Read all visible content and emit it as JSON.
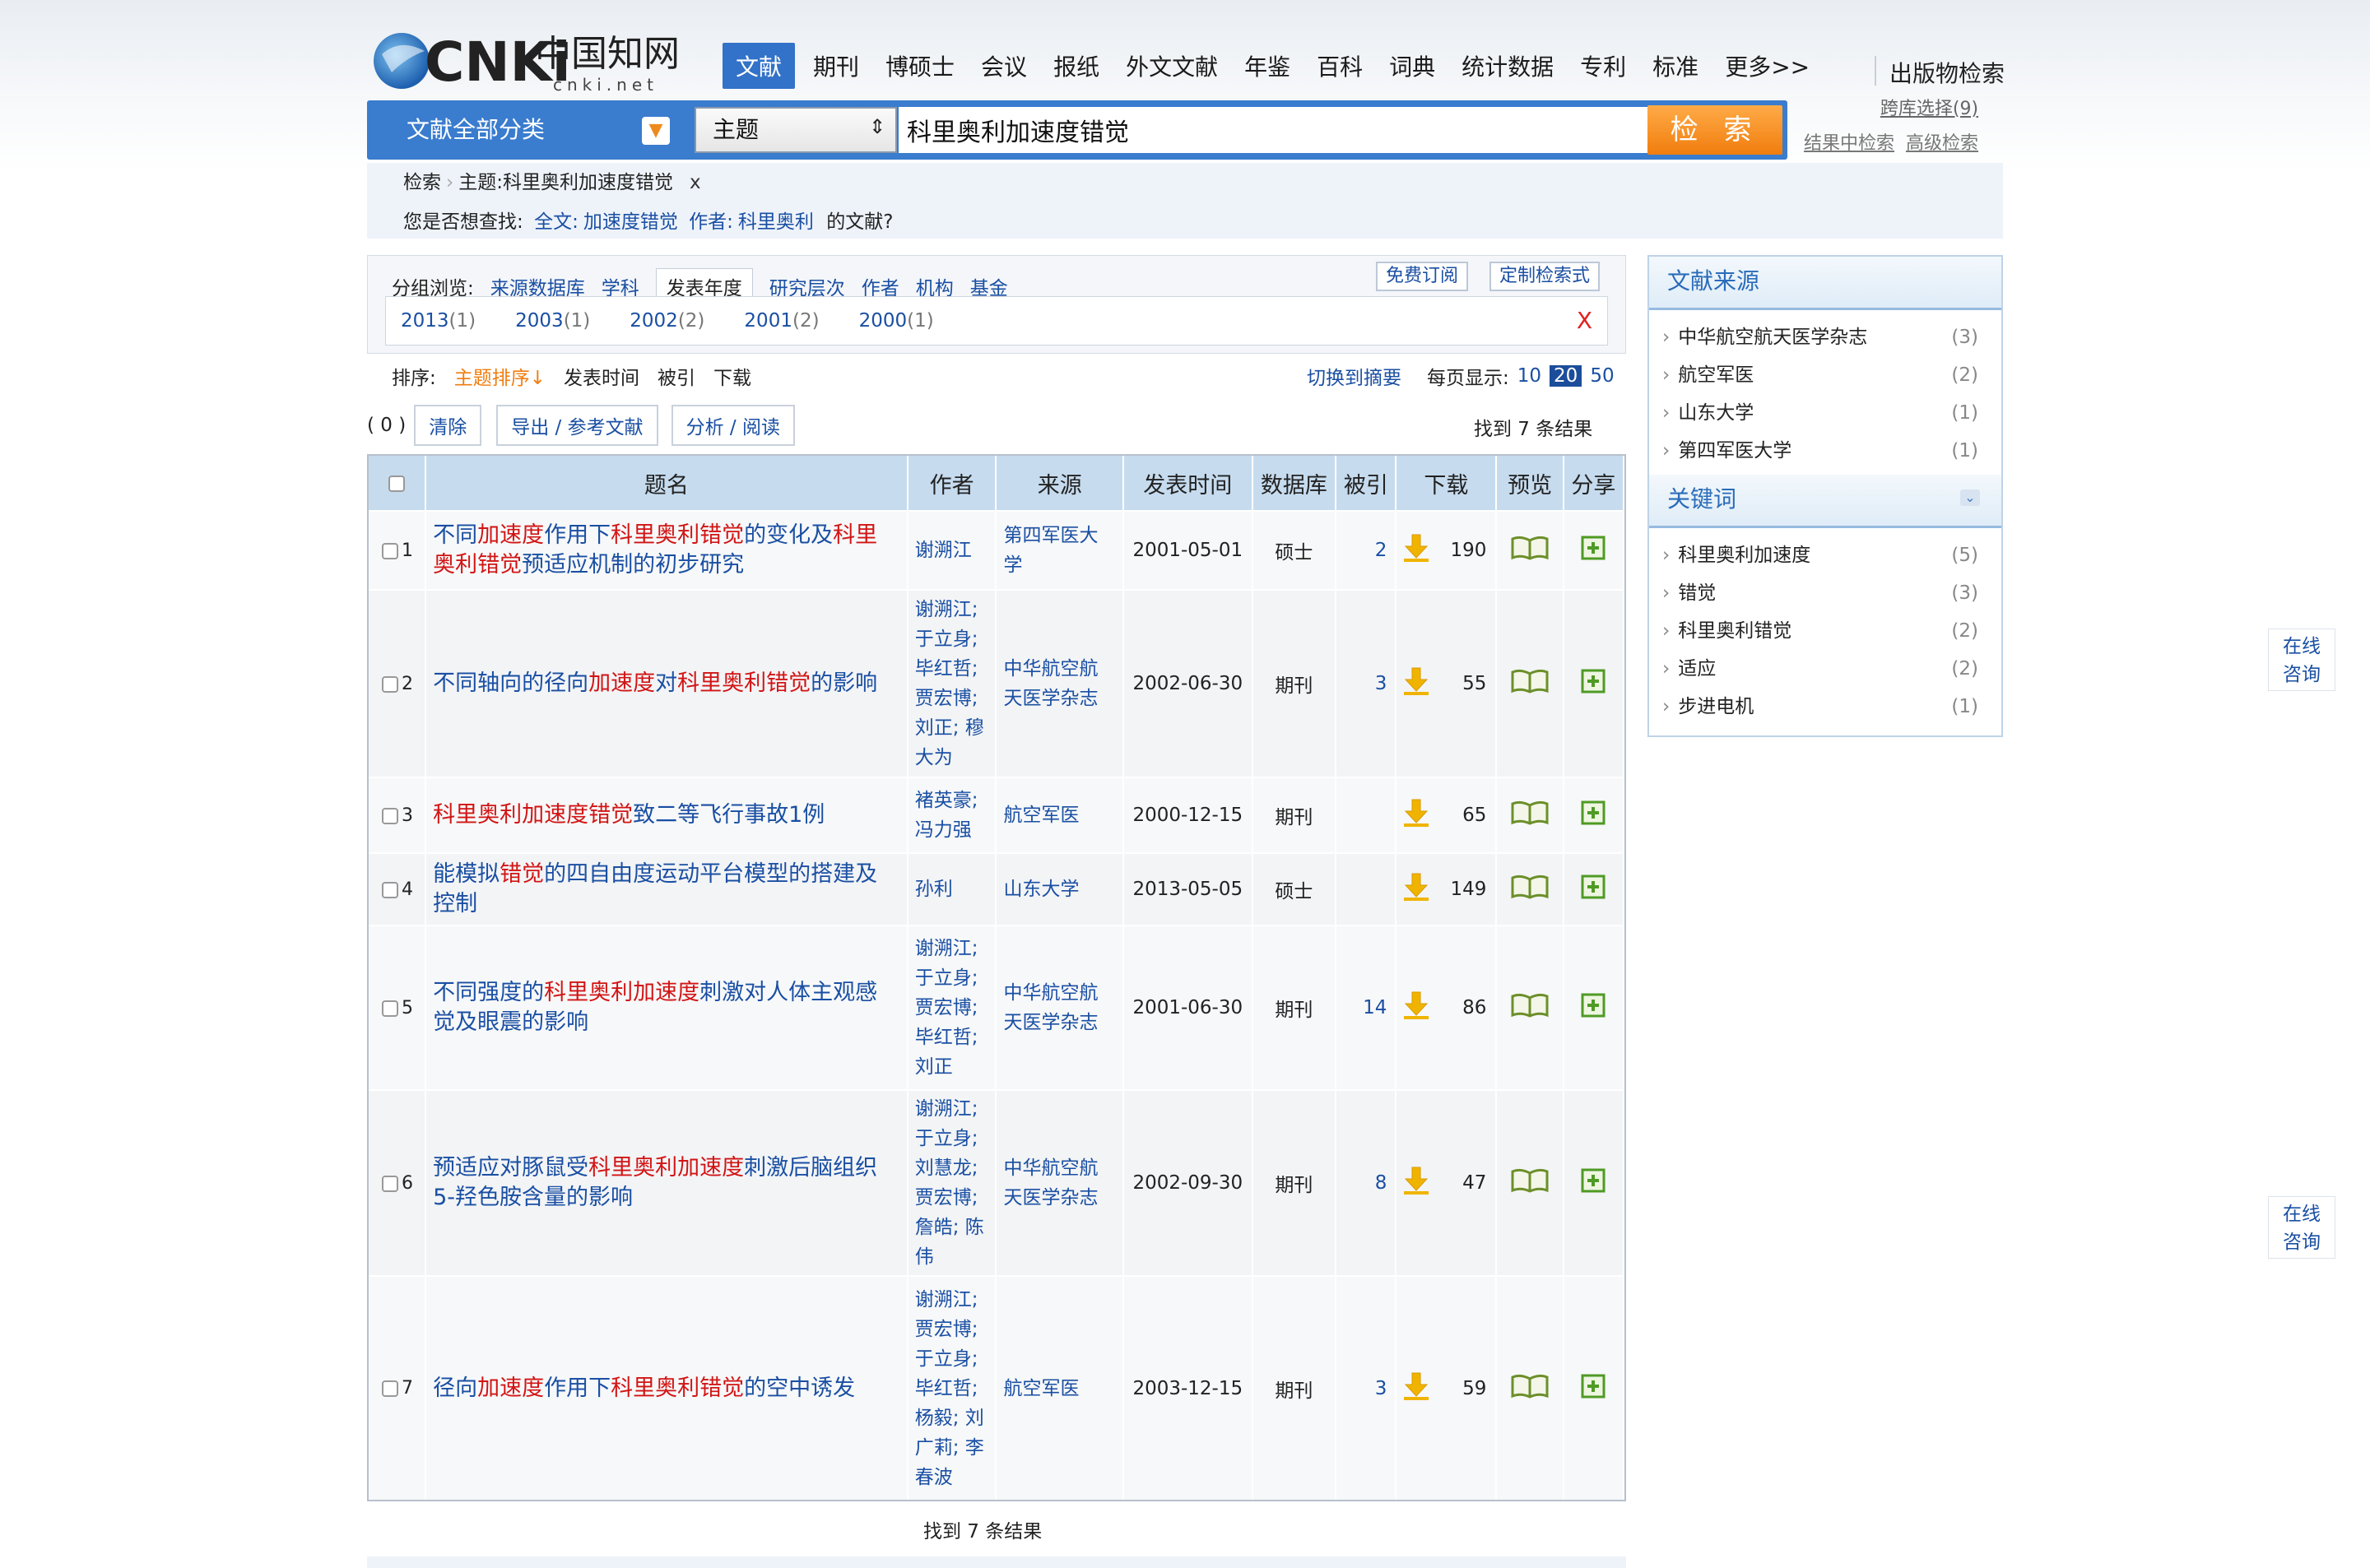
{
  "header": {
    "logo_text": "CNKi",
    "logo_cn": "中国知网",
    "logo_url": "cnki.net",
    "nav": [
      "文献",
      "期刊",
      "博硕士",
      "会议",
      "报纸",
      "外文文献",
      "年鉴",
      "百科",
      "词典",
      "统计数据",
      "专利",
      "标准",
      "更多>>"
    ],
    "pub_search": "出版物检索"
  },
  "search": {
    "category": "文献全部分类",
    "field": "主题",
    "query": "科里奥利加速度错觉",
    "button": "检 索",
    "cross_db": "跨库选择(9)",
    "in_results": "结果中检索",
    "advanced": "高级检索"
  },
  "breadcrumb": {
    "root": "检索",
    "current": "主题:科里奥利加速度错觉",
    "remove": "x"
  },
  "suggest": {
    "prefix": "您是否想查找:",
    "fulltext_label": "全文:",
    "fulltext_value": "加速度错觉",
    "author_label": "作者:",
    "author_value": "科里奥利",
    "suffix": "的文献?"
  },
  "group": {
    "label": "分组浏览:",
    "tabs": [
      "来源数据库",
      "学科",
      "发表年度",
      "研究层次",
      "作者",
      "机构",
      "基金"
    ],
    "selected_tab": "发表年度",
    "subscribe": "免费订阅",
    "custom": "定制检索式",
    "years": [
      {
        "year": "2013",
        "count": "(1)"
      },
      {
        "year": "2003",
        "count": "(1)"
      },
      {
        "year": "2002",
        "count": "(2)"
      },
      {
        "year": "2001",
        "count": "(2)"
      },
      {
        "year": "2000",
        "count": "(1)"
      }
    ],
    "close": "X"
  },
  "sort": {
    "label": "排序:",
    "options": [
      "主题排序↓",
      "发表时间",
      "被引",
      "下载"
    ],
    "switch": "切换到摘要",
    "per_page_label": "每页显示:",
    "per_page": [
      "10",
      "20",
      "50"
    ]
  },
  "actions": {
    "count": "( 0 )",
    "clear": "清除",
    "export": "导出 / 参考文献",
    "analyze": "分析 / 阅读",
    "found": "找到 7 条结果"
  },
  "table": {
    "headers": [
      "题名",
      "作者",
      "来源",
      "发表时间",
      "数据库",
      "被引",
      "下载",
      "预览",
      "分享"
    ],
    "rows": [
      {
        "num": "1",
        "title": [
          {
            "t": "不同"
          },
          {
            "t": "加速度",
            "h": true
          },
          {
            "t": "作用下"
          },
          {
            "t": "科里奥利错觉",
            "h": true
          },
          {
            "t": "的变化及"
          },
          {
            "t": "科里奥利错觉",
            "h": true
          },
          {
            "t": "预适应机制的初步研究"
          }
        ],
        "authors": "谢溯江",
        "source": "第四军医大学",
        "date": "2001-05-01",
        "db": "硕士",
        "cite": "2",
        "dl": "190"
      },
      {
        "num": "2",
        "title": [
          {
            "t": "不同轴向的径向"
          },
          {
            "t": "加速度",
            "h": true
          },
          {
            "t": "对"
          },
          {
            "t": "科里奥利错觉",
            "h": true
          },
          {
            "t": "的影响"
          }
        ],
        "authors": "谢溯江; 于立身; 毕红哲; 贾宏博; 刘正; 穆大为",
        "source": "中华航空航天医学杂志",
        "date": "2002-06-30",
        "db": "期刊",
        "cite": "3",
        "dl": "55"
      },
      {
        "num": "3",
        "title": [
          {
            "t": "科里奥利加速度错觉",
            "h": true
          },
          {
            "t": "致二等飞行事故1例"
          }
        ],
        "authors": "褚英豪; 冯力强",
        "source": "航空军医",
        "date": "2000-12-15",
        "db": "期刊",
        "cite": "",
        "dl": "65"
      },
      {
        "num": "4",
        "title": [
          {
            "t": "能模拟"
          },
          {
            "t": "错觉",
            "h": true
          },
          {
            "t": "的四自由度运动平台模型的搭建及控制"
          }
        ],
        "authors": "孙利",
        "source": "山东大学",
        "date": "2013-05-05",
        "db": "硕士",
        "cite": "",
        "dl": "149"
      },
      {
        "num": "5",
        "title": [
          {
            "t": "不同强度的"
          },
          {
            "t": "科里奥利加速度",
            "h": true
          },
          {
            "t": "刺激对人体主观感觉及眼震的影响"
          }
        ],
        "authors": "谢溯江; 于立身; 贾宏博; 毕红哲; 刘正",
        "source": "中华航空航天医学杂志",
        "date": "2001-06-30",
        "db": "期刊",
        "cite": "14",
        "dl": "86"
      },
      {
        "num": "6",
        "title": [
          {
            "t": "预适应对豚鼠受"
          },
          {
            "t": "科里奥利加速度",
            "h": true
          },
          {
            "t": "刺激后脑组织5-羟色胺含量的影响"
          }
        ],
        "authors": "谢溯江; 于立身; 刘慧龙; 贾宏博; 詹皓; 陈伟",
        "source": "中华航空航天医学杂志",
        "date": "2002-09-30",
        "db": "期刊",
        "cite": "8",
        "dl": "47"
      },
      {
        "num": "7",
        "title": [
          {
            "t": "径向"
          },
          {
            "t": "加速度",
            "h": true
          },
          {
            "t": "作用下"
          },
          {
            "t": "科里奥利错觉",
            "h": true
          },
          {
            "t": "的空中诱发"
          }
        ],
        "authors": "谢溯江; 贾宏博; 于立身; 毕红哲; 杨毅; 刘广莉; 李春波",
        "source": "航空军医",
        "date": "2003-12-15",
        "db": "期刊",
        "cite": "3",
        "dl": "59"
      }
    ],
    "found_bottom": "找到 7 条结果"
  },
  "sidebar": {
    "source_title": "文献来源",
    "sources": [
      {
        "name": "中华航空航天医学杂志",
        "count": "(3)"
      },
      {
        "name": "航空军医",
        "count": "(2)"
      },
      {
        "name": "山东大学",
        "count": "(1)"
      },
      {
        "name": "第四军医大学",
        "count": "(1)"
      }
    ],
    "keyword_title": "关键词",
    "keywords": [
      {
        "name": "科里奥利加速度",
        "count": "(5)"
      },
      {
        "name": "错觉",
        "count": "(3)"
      },
      {
        "name": "科里奥利错觉",
        "count": "(2)"
      },
      {
        "name": "适应",
        "count": "(2)"
      },
      {
        "name": "步进电机",
        "count": "(1)"
      }
    ]
  },
  "consult": {
    "line1": "在线",
    "line2": "咨询"
  },
  "colors": {
    "brand_blue": "#3a7cce",
    "highlight_red": "#d21414",
    "link_blue": "#1a4fa3",
    "search_orange": "#f07d0e"
  }
}
